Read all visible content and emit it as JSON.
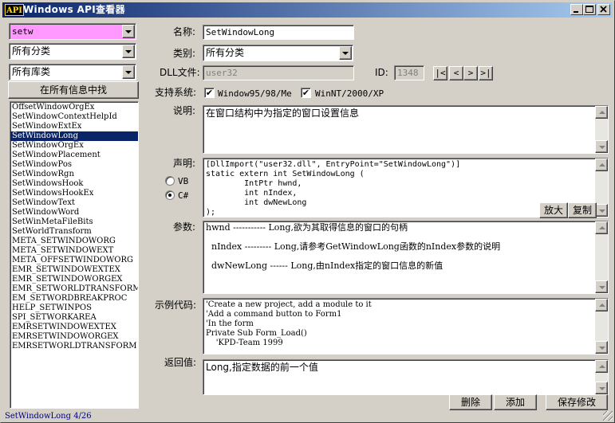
{
  "window": {
    "icon_text": "API",
    "title": "Windows API查看器"
  },
  "left": {
    "search_value": "setw",
    "category_combo": "所有分类",
    "library_combo": "所有库类",
    "find_all_button": "在所有信息中找",
    "items": [
      "OffsetWindowOrgEx",
      "SetWindowContextHelpId",
      "SetWindowExtEx",
      "SetWindowLong",
      "SetWindowOrgEx",
      "SetWindowPlacement",
      "SetWindowPos",
      "SetWindowRgn",
      "SetWindowsHook",
      "SetWindowsHookEx",
      "SetWindowText",
      "SetWindowWord",
      "SetWinMetaFileBits",
      "SetWorldTransform",
      "META_SETWINDOWORG",
      "META_SETWINDOWEXT",
      "META_OFFSETWINDOWORG",
      "EMR_SETWINDOWEXTEX",
      "EMR_SETWINDOWORGEX",
      "EMR_SETWORLDTRANSFORM",
      "EM_SETWORDBREAKPROC",
      "HELP_SETWINPOS",
      "SPI_SETWORKAREA",
      "EMRSETWINDOWEXTEX",
      "EMRSETWINDOWORGEX",
      "EMRSETWORLDTRANSFORM"
    ],
    "selected_index": 3
  },
  "form": {
    "name_label": "名称:",
    "name_value": "SetWindowLong",
    "category_label": "类别:",
    "category_value": "所有分类",
    "dll_label": "DLL文件:",
    "dll_value": "user32",
    "id_label": "ID:",
    "id_value": "1348",
    "nav": {
      "first": "|<",
      "prev": "<",
      "next": ">",
      "last": ">|"
    },
    "support_label": "支持系统:",
    "win95_label": "Window95/98/Me",
    "winnt_label": "WinNT/2000/XP",
    "win95_checked": "✔",
    "winnt_checked": "✔",
    "desc_label": "说明:",
    "desc_value": "在窗口结构中为指定的窗口设置信息",
    "decl_label": "声明:",
    "vb_label": "VB",
    "cs_label": "C#",
    "selected_language": "C#",
    "decl_value": "[DllImport(\"user32.dll\", EntryPoint=\"SetWindowLong\")]\nstatic extern int SetWindowLong (\n        IntPtr hwnd,\n        int nIndex,\n        int dwNewLong\n);",
    "enlarge_button": "放大",
    "copy_button": "复制",
    "params_label": "参数:",
    "params_value": "hwnd ----------- Long,欲为其取得信息的窗口的句柄\n\n  nIndex --------- Long,请参考GetWindowLong函数的nIndex参数的说明\n\n  dwNewLong ------ Long,由nIndex指定的窗口信息的新值",
    "example_label": "示例代码:",
    "example_value": "'Create a new project, add a module to it\n'Add a command button to Form1\n'In the form\nPrivate Sub Form_Load()\n    'KPD-Team 1999",
    "return_label": "返回值:",
    "return_value": "Long,指定数据的前一个值",
    "delete_button": "删除",
    "add_button": "添加",
    "save_button": "保存修改"
  },
  "status": {
    "text": "SetWindowLong 4/26"
  },
  "colors": {
    "face": "#d4d0c8",
    "titlebar": "#0a246a",
    "search_highlight": "#ff99ff",
    "status_text": "#000080"
  }
}
